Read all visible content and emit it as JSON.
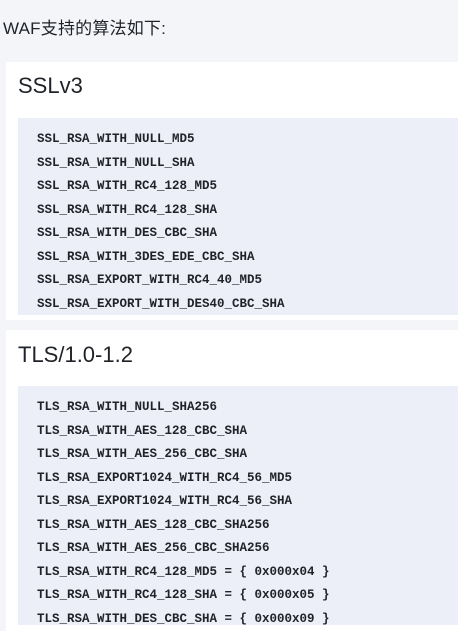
{
  "intro": "WAF支持的算法如下:",
  "sections": [
    {
      "title": "SSLv3",
      "lines": [
        "SSL_RSA_WITH_NULL_MD5",
        "SSL_RSA_WITH_NULL_SHA",
        "SSL_RSA_WITH_RC4_128_MD5",
        "SSL_RSA_WITH_RC4_128_SHA",
        "SSL_RSA_WITH_DES_CBC_SHA",
        "SSL_RSA_WITH_3DES_EDE_CBC_SHA",
        "SSL_RSA_EXPORT_WITH_RC4_40_MD5",
        "SSL_RSA_EXPORT_WITH_DES40_CBC_SHA"
      ]
    },
    {
      "title": "TLS/1.0-1.2",
      "lines": [
        "TLS_RSA_WITH_NULL_SHA256",
        "TLS_RSA_WITH_AES_128_CBC_SHA",
        "TLS_RSA_WITH_AES_256_CBC_SHA",
        "TLS_RSA_EXPORT1024_WITH_RC4_56_MD5",
        "TLS_RSA_EXPORT1024_WITH_RC4_56_SHA",
        "TLS_RSA_WITH_AES_128_CBC_SHA256",
        "TLS_RSA_WITH_AES_256_CBC_SHA256",
        "TLS_RSA_WITH_RC4_128_MD5 = { 0x000x04 }",
        "TLS_RSA_WITH_RC4_128_SHA = { 0x000x05 }",
        "TLS_RSA_WITH_DES_CBC_SHA = { 0x000x09 }"
      ]
    }
  ]
}
